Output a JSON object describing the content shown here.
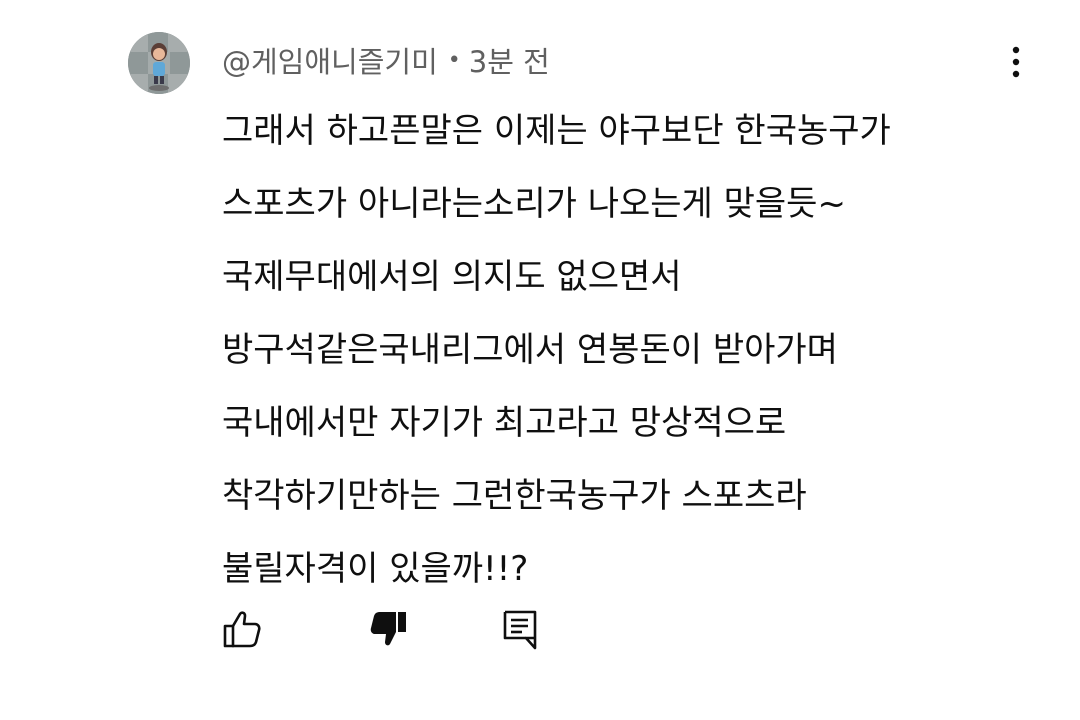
{
  "comment": {
    "author": "@게임애니즐기미",
    "separator": "•",
    "time": "3분 전",
    "lines": [
      "그래서 하고픈말은 이제는 야구보단 한국농구가",
      "스포츠가 아니라는소리가 나오는게 맞을듯~",
      "국제무대에서의 의지도 없으면서",
      "방구석같은국내리그에서 연봉돈이 받아가며",
      "국내에서만 자기가 최고라고 망상적으로",
      "착각하기만하는 그런한국농구가 스포츠라",
      "불릴자격이 있을까!!?"
    ]
  },
  "icons": {
    "avatar": "avatar",
    "more": "more-vert-icon",
    "like": "thumbs-up-outline-icon",
    "dislike": "thumbs-down-filled-icon",
    "reply": "reply-comment-icon"
  },
  "colors": {
    "text": "#0f0f0f",
    "meta": "#606060",
    "icon": "#0f0f0f"
  }
}
